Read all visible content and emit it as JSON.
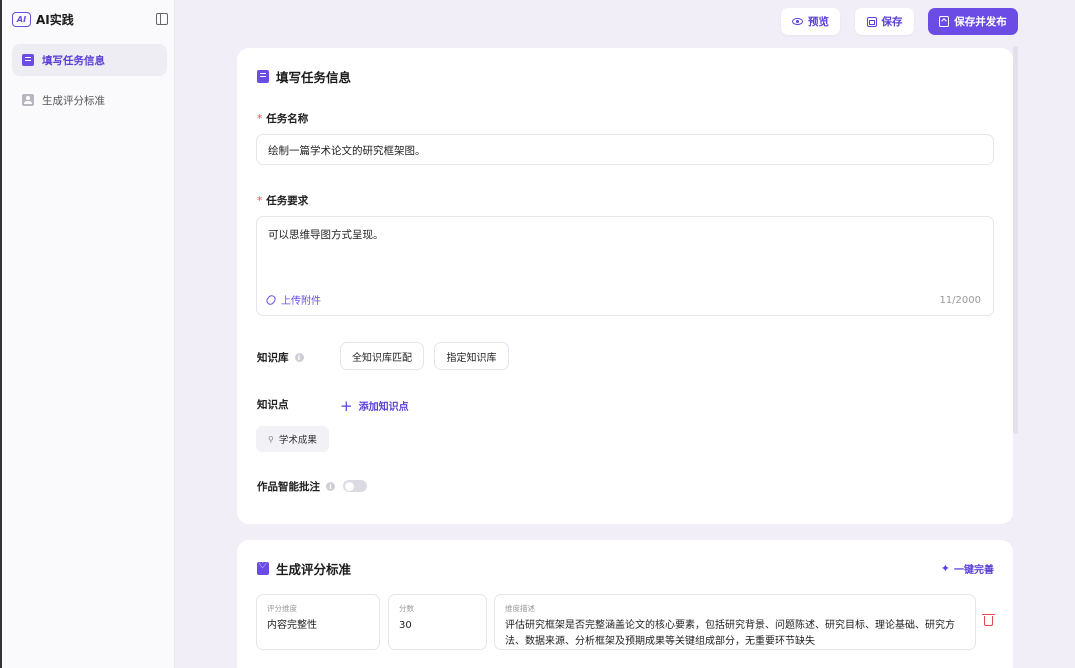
{
  "app": {
    "logo_badge": "AI",
    "title": "AI实践"
  },
  "sidebar": {
    "items": [
      {
        "label": "填写任务信息",
        "active": true
      },
      {
        "label": "生成评分标准",
        "active": false
      }
    ]
  },
  "toolbar": {
    "preview_label": "预览",
    "save_label": "保存",
    "publish_label": "保存并发布"
  },
  "task_card": {
    "title": "填写任务信息",
    "name_label": "任务名称",
    "name_value": "绘制一篇学术论文的研究框架图。",
    "req_label": "任务要求",
    "req_value": "可以思维导图方式呈现。",
    "upload_label": "上传附件",
    "counter": "11/2000",
    "kb_label": "知识库",
    "kb_options": [
      "全知识库匹配",
      "指定知识库"
    ],
    "kp_label": "知识点",
    "add_kp_label": "添加知识点",
    "kp_tags": [
      "学术成果"
    ],
    "annotate_label": "作品智能批注",
    "annotate_enabled": false
  },
  "rubric_card": {
    "title": "生成评分标准",
    "one_click_label": "一键完善",
    "rows": [
      {
        "dimension_caption": "评分维度",
        "dimension": "内容完整性",
        "score_caption": "分数",
        "score": "30",
        "desc_caption": "维度描述",
        "desc": "评估研究框架是否完整涵盖论文的核心要素，包括研究背景、问题陈述、研究目标、理论基础、研究方法、数据来源、分析框架及预期成果等关键组成部分，无重要环节缺失"
      }
    ]
  },
  "colors": {
    "accent": "#6b4de6",
    "danger": "#e5484d",
    "background": "#f2eef8"
  }
}
